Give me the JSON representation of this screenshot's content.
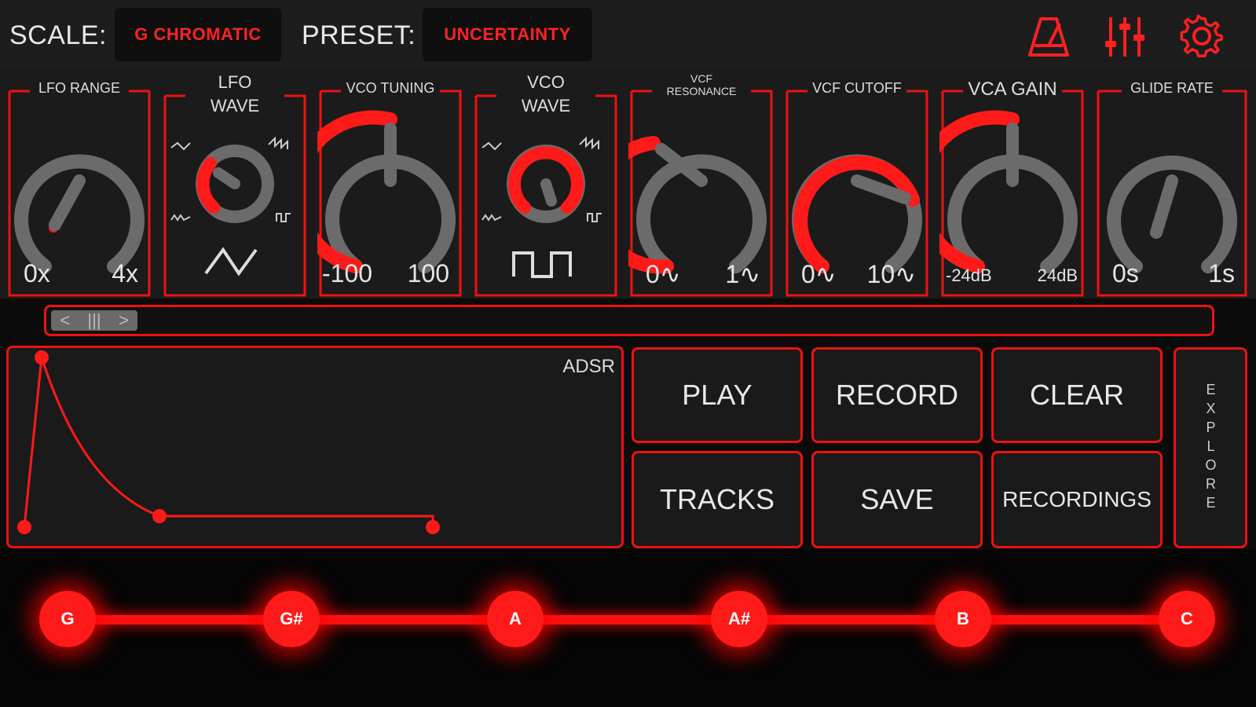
{
  "header": {
    "scale_label": "SCALE:",
    "scale_value": "G CHROMATIC",
    "preset_label": "PRESET:",
    "preset_value": "UNCERTAINTY",
    "icons": [
      "metronome-icon",
      "mixer-sliders-icon",
      "gear-icon"
    ]
  },
  "knobs": [
    {
      "title": "LFO RANGE",
      "min": "0x",
      "max": "4x",
      "level": 0.0
    },
    {
      "title": "VCO TUNING",
      "min": "-100",
      "max": "100",
      "level": 0.55
    },
    {
      "title": "VCF RESONANCE",
      "min": "0∿",
      "max": "1∿",
      "level": 0.3
    },
    {
      "title": "VCF CUTOFF",
      "min": "0∿",
      "max": "10∿",
      "level": 0.75
    },
    {
      "title": "VCA GAIN",
      "min": "-24dB",
      "max": "24dB",
      "level": 0.5
    },
    {
      "title": "GLIDE RATE",
      "min": "0s",
      "max": "1s",
      "level": 0.0
    }
  ],
  "selectors": [
    {
      "title": "LFO WAVE",
      "selected": "triangle"
    },
    {
      "title": "VCO WAVE",
      "selected": "square"
    }
  ],
  "envelope": {
    "label": "ADSR"
  },
  "buttons": {
    "play": "PLAY",
    "record": "RECORD",
    "clear": "CLEAR",
    "tracks": "TRACKS",
    "save": "SAVE",
    "recordings": "RECORDINGS",
    "explore": "EXPLORE"
  },
  "notes": [
    "G",
    "G#",
    "A",
    "A#",
    "B",
    "C"
  ],
  "colors": {
    "accent": "#ff1a1a",
    "panel": "#1b1b1b",
    "knob_track": "#6b6b6b"
  }
}
